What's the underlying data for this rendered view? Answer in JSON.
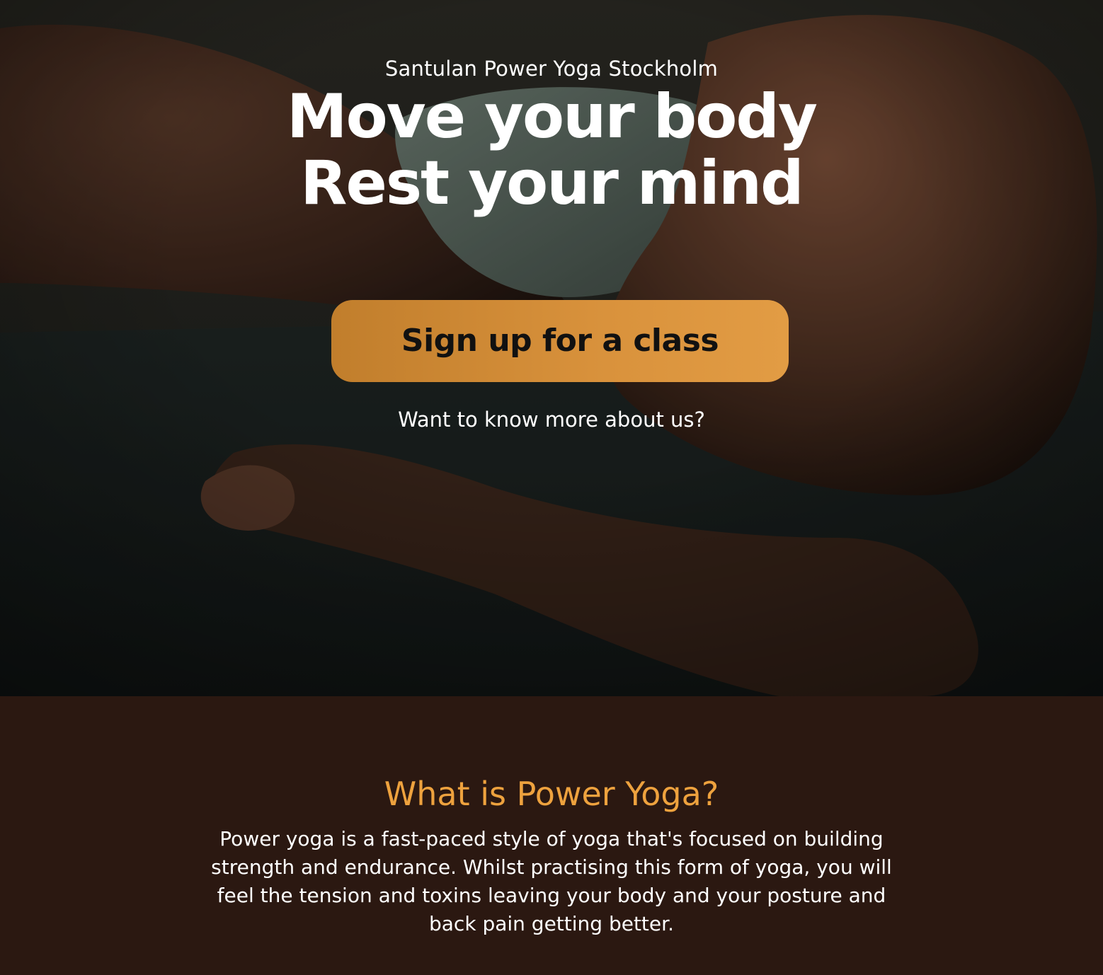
{
  "hero": {
    "eyebrow": "Santulan Power Yoga Stockholm",
    "headline_line1": "Move your body",
    "headline_line2": "Rest your mind",
    "cta_label": "Sign up for a class",
    "more_link": "Want to know more about us?"
  },
  "info": {
    "title": "What is Power Yoga?",
    "body": "Power yoga is a fast-paced style of yoga that's focused on building strength and endurance. Whilst practising this form of yoga, you will feel the tension and toxins leaving your body and your posture and back pain getting better."
  },
  "colors": {
    "accent": "#eea23e",
    "cta": "#d9923c",
    "section_bg": "#2b1811"
  }
}
